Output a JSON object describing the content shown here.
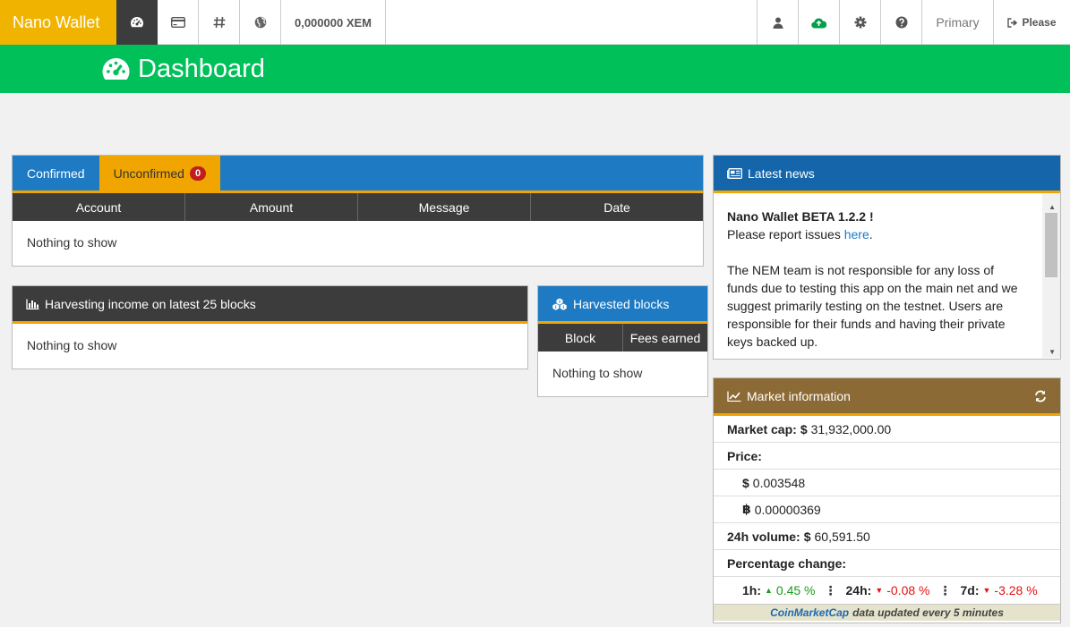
{
  "topbar": {
    "brand": "Nano Wallet",
    "balance": "0,000000 XEM",
    "account_label": "Primary",
    "logout_label": "Please"
  },
  "header": {
    "title": "Dashboard"
  },
  "transactions": {
    "tabs": {
      "confirmed": "Confirmed",
      "unconfirmed": "Unconfirmed",
      "unconfirmed_count": "0"
    },
    "columns": [
      "Account",
      "Amount",
      "Message",
      "Date"
    ],
    "empty": "Nothing to show"
  },
  "harvest_income": {
    "title": "Harvesting income on latest 25 blocks",
    "empty": "Nothing to show"
  },
  "harvested_blocks": {
    "title": "Harvested blocks",
    "columns": [
      "Block",
      "Fees earned"
    ],
    "empty": "Nothing to show"
  },
  "news": {
    "title": "Latest news",
    "headline": "Nano Wallet BETA 1.2.2 !",
    "report_prefix": "Please report issues ",
    "report_link": "here",
    "report_suffix": ".",
    "body": "The NEM team is not responsible for any loss of funds due to testing this app on the main net and we suggest primarily testing on the testnet. Users are responsible for their funds and having their private keys backed up."
  },
  "market": {
    "title": "Market information",
    "market_cap_label": "Market cap:",
    "market_cap_value": "31,932,000.00",
    "price_label": "Price:",
    "price_usd": "0.003548",
    "price_btc": "0.00000369",
    "volume_label": "24h volume:",
    "volume_value": "60,591.50",
    "pct_label": "Percentage change:",
    "h1_label": "1h:",
    "h1_value": "0.45 %",
    "h24_label": "24h:",
    "h24_value": "-0.08 %",
    "d7_label": "7d:",
    "d7_value": "-3.28 %",
    "footer_link": "CoinMarketCap",
    "footer_text": "data updated every 5 minutes"
  },
  "colors": {
    "accent": "#f0b400",
    "green": "#00c05a",
    "blue": "#1d7ac3",
    "brown": "#8b6a35"
  }
}
